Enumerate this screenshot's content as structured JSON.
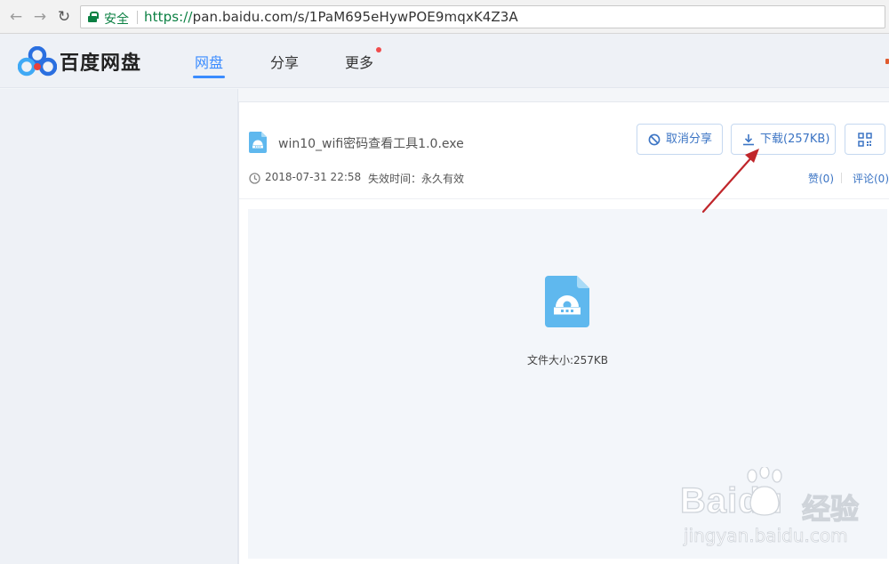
{
  "browser": {
    "security_label": "安全",
    "url_scheme": "https://",
    "url_rest": "pan.baidu.com/s/1PaM695eHywPOE9mqxK4Z3A"
  },
  "header": {
    "logo_text": "百度网盘",
    "tabs": [
      {
        "label": "网盘",
        "active": true
      },
      {
        "label": "分享",
        "active": false
      },
      {
        "label": "更多",
        "active": false,
        "has_badge": true
      }
    ]
  },
  "file": {
    "name": "win10_wifi密码查看工具1.0.exe",
    "date": "2018-07-31 22:58",
    "expire_label": "失效时间：",
    "expire_value": "永久有效",
    "like": "赞(0)",
    "comment": "评论(0)",
    "size_text": "文件大小:257KB"
  },
  "actions": {
    "cancel_share": "取消分享",
    "download": "下载(257KB)"
  },
  "watermark": {
    "brand": "Baidu",
    "product": "经验",
    "url": "jingyan.baidu.com"
  },
  "colors": {
    "accent": "#3b8cff",
    "secure_green": "#0b8043",
    "file_icon": "#5fb8ee",
    "annotation_arrow": "#c0262b"
  },
  "icons": [
    "back-arrow-icon",
    "forward-arrow-icon",
    "reload-icon",
    "lock-icon",
    "baidu-cloud-logo",
    "file-exe-icon",
    "cancel-circle-icon",
    "download-icon",
    "qr-code-icon",
    "clock-icon"
  ]
}
